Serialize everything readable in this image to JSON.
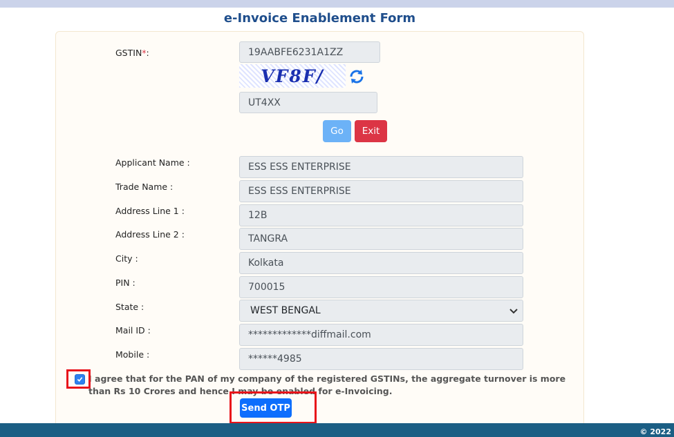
{
  "page": {
    "title": "e-Invoice Enablement Form"
  },
  "form": {
    "gstin_label": "GSTIN",
    "gstin_required_mark": "*",
    "gstin_label_suffix": ":",
    "gstin_value": "19AABFE6231A1ZZ",
    "captcha_image_text": "VF8F/",
    "captcha_input_value": "UT4XX",
    "go_label": "Go",
    "exit_label": "Exit",
    "fields": [
      {
        "label": "Applicant Name :",
        "value": "ESS ESS ENTERPRISE"
      },
      {
        "label": "Trade Name :",
        "value": "ESS ESS ENTERPRISE"
      },
      {
        "label": "Address Line 1 :",
        "value": "12B"
      },
      {
        "label": "Address Line 2 :",
        "value": "TANGRA"
      },
      {
        "label": "City :",
        "value": "Kolkata"
      },
      {
        "label": "PIN :",
        "value": "700015"
      },
      {
        "label": "State :",
        "value": "WEST BENGAL"
      },
      {
        "label": "Mail ID :",
        "value": "*************diffmail.com"
      },
      {
        "label": "Mobile :",
        "value": "******4985"
      }
    ],
    "agree_checked": true,
    "agree_text": "I agree that for the PAN of my company of the registered GSTINs, the aggregate turnover is more than Rs 10 Crores and hence I may be enabled for e-Invoicing.",
    "send_otp_label": "Send OTP"
  },
  "footer": {
    "copyright": "© 2022"
  },
  "colors": {
    "title": "#1f4e8c",
    "go_button": "#6cb2f7",
    "exit_button": "#dc3545",
    "send_otp_button": "#0d6efd",
    "footer": "#1b5e84",
    "highlight_box": "#e8131a"
  }
}
